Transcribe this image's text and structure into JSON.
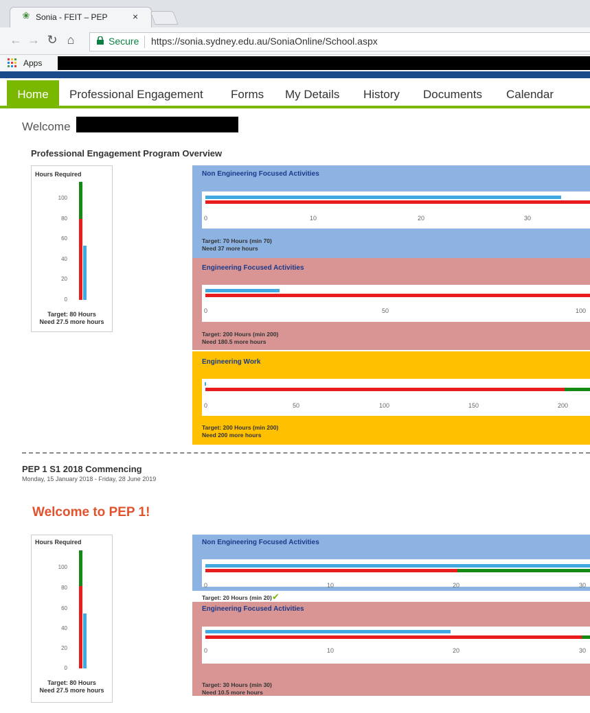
{
  "browser": {
    "tab_title": "Sonia - FEIT – PEP",
    "tab_close": "×",
    "secure_label": "Secure",
    "url": "https://sonia.sydney.edu.au/SoniaOnline/School.aspx",
    "bookmarks": {
      "apps_label": "Apps"
    }
  },
  "nav": {
    "items": [
      "Home",
      "Professional Engagement",
      "Forms",
      "My Details",
      "History",
      "Documents",
      "Calendar"
    ],
    "active": "Home",
    "accent_color": "#7ab800"
  },
  "welcome": {
    "label": "Welcome"
  },
  "overview": {
    "title": "Professional Engagement Program Overview",
    "hours_box": {
      "title": "Hours Required",
      "ticks": [
        "100",
        "80",
        "60",
        "40",
        "20",
        "0"
      ],
      "target": "Target: 80 Hours",
      "need": "Need 27.5 more hours"
    },
    "panels": [
      {
        "title": "Non Engineering Focused Activities",
        "color": "#8db3e2",
        "axis": [
          "0",
          "10",
          "20",
          "30"
        ],
        "target": "Target: 70 Hours (min 70)",
        "need": "Need 37 more hours"
      },
      {
        "title": "Engineering Focused Activities",
        "color": "#d99594",
        "axis": [
          "0",
          "50",
          "100"
        ],
        "target": "Target: 200 Hours (min 200)",
        "need": "Need 180.5 more hours"
      },
      {
        "title": "Engineering Work",
        "color": "#ffc000",
        "axis": [
          "0",
          "50",
          "100",
          "150",
          "200"
        ],
        "target": "Target: 200 Hours (min 200)",
        "need": "Need 200 more hours"
      }
    ]
  },
  "pep1": {
    "title": "PEP 1 S1 2018 Commencing",
    "dates": "Monday, 15 January 2018 - Friday, 28 June 2019",
    "welcome": "Welcome to PEP 1!",
    "hours_box": {
      "title": "Hours Required",
      "ticks": [
        "100",
        "80",
        "60",
        "40",
        "20",
        "0"
      ],
      "target": "Target: 80 Hours",
      "need": "Need 27.5 more hours"
    },
    "panels": [
      {
        "title": "Non Engineering Focused Activities",
        "color": "#8db3e2",
        "axis": [
          "0",
          "10",
          "20",
          "30"
        ],
        "target": "Target: 20 Hours (min 20)",
        "complete": true
      },
      {
        "title": "Engineering Focused Activities",
        "color": "#d99594",
        "axis": [
          "0",
          "10",
          "20",
          "30"
        ],
        "target": "Target: 30 Hours (min 30)",
        "need": "Need 10.5 more hours"
      }
    ]
  },
  "colors": {
    "progress": "#3fa9e0",
    "required": "#e81c1c",
    "extra": "#148a14"
  }
}
